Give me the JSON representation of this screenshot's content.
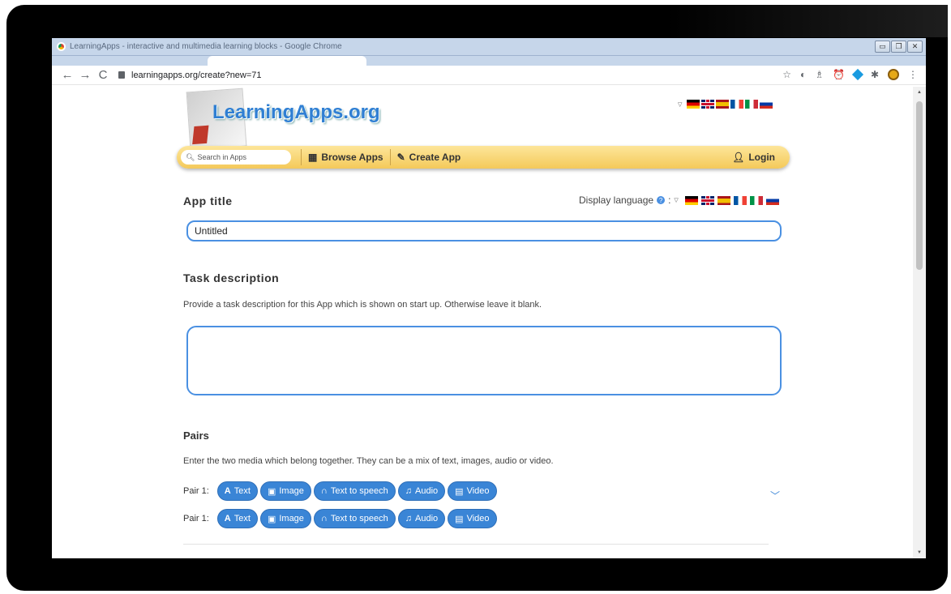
{
  "window": {
    "title": "LearningApps - interactive and multimedia learning blocks - Google Chrome",
    "url": "learningapps.org/create?new=71"
  },
  "site": {
    "logo": "LearningApps.org",
    "search_placeholder": "Search in Apps",
    "nav": {
      "browse": "Browse Apps",
      "create": "Create App",
      "login": "Login"
    },
    "flags": [
      "de",
      "gb",
      "es",
      "fr",
      "it",
      "ru"
    ]
  },
  "form": {
    "app_title_heading": "App title",
    "display_language": "Display language",
    "title_value": "Untitled",
    "task_heading": "Task description",
    "task_hint": "Provide a task description for this App which is shown on start up. Otherwise leave it blank.",
    "pairs_heading": "Pairs",
    "pairs_hint": "Enter the two media which belong together. They can be a mix of text, images, audio or video.",
    "pairs": [
      {
        "label": "Pair 1:",
        "buttons": [
          "Text",
          "Image",
          "Text to speech",
          "Audio",
          "Video"
        ]
      },
      {
        "label": "Pair 1:",
        "buttons": [
          "Text",
          "Image",
          "Text to speech",
          "Audio",
          "Video"
        ]
      }
    ]
  }
}
